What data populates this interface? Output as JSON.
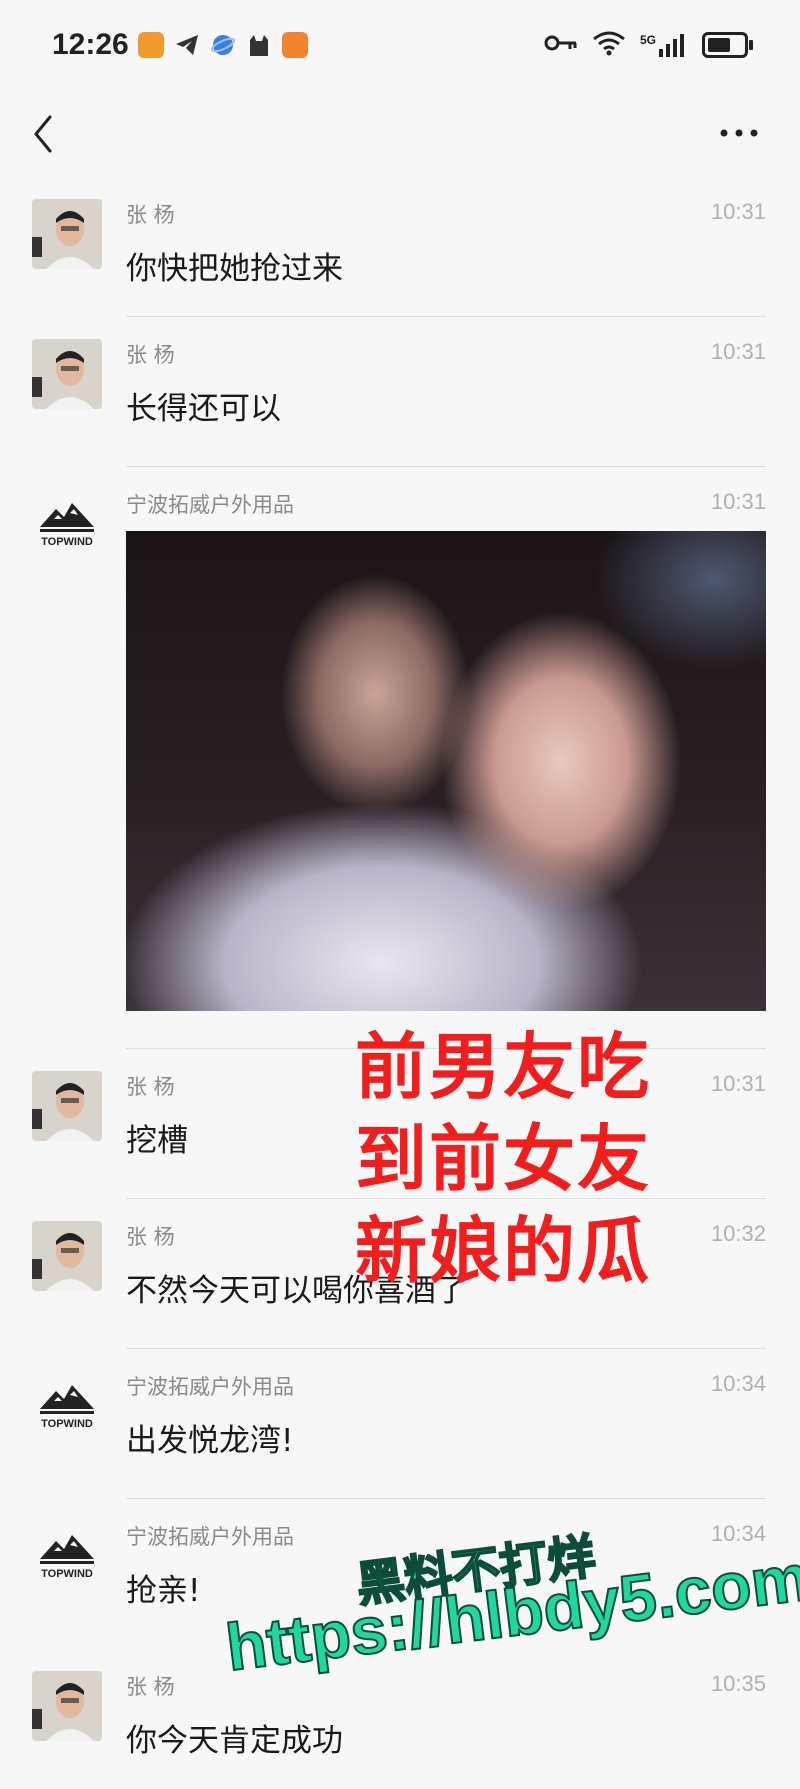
{
  "status_bar": {
    "time": "12:26",
    "network": "5G",
    "app_icons": [
      "app-orange-icon",
      "telegram-icon",
      "browser-icon",
      "cat-icon",
      "app-orange-icon"
    ]
  },
  "messages": [
    {
      "sender": "张 杨",
      "time": "10:31",
      "text": "你快把她抢过来",
      "avatar": "person"
    },
    {
      "sender": "张 杨",
      "time": "10:31",
      "text": "长得还可以",
      "avatar": "person"
    },
    {
      "sender": "宁波拓威户外用品",
      "time": "10:31",
      "text": "",
      "avatar": "brand",
      "image": true
    },
    {
      "sender": "张 杨",
      "time": "10:31",
      "text": "挖槽",
      "avatar": "person"
    },
    {
      "sender": "张 杨",
      "time": "10:32",
      "text": "不然今天可以喝你喜酒了",
      "avatar": "person"
    },
    {
      "sender": "宁波拓威户外用品",
      "time": "10:34",
      "text": "出发悦龙湾!",
      "avatar": "brand"
    },
    {
      "sender": "宁波拓威户外用品",
      "time": "10:34",
      "text": "抢亲!",
      "avatar": "brand"
    },
    {
      "sender": "张 杨",
      "time": "10:35",
      "text": "你今天肯定成功",
      "avatar": "person"
    }
  ],
  "brand_logo_text": "TOPWIND",
  "overlay": {
    "line1": "前男友吃",
    "line2": "到前女友",
    "line3": "新娘的瓜"
  },
  "watermark": {
    "line1": "黑料不打烊",
    "line2": "https://hlbdy5.com"
  },
  "colors": {
    "headline": "#f21e1e",
    "watermark": "#22d6a0"
  }
}
